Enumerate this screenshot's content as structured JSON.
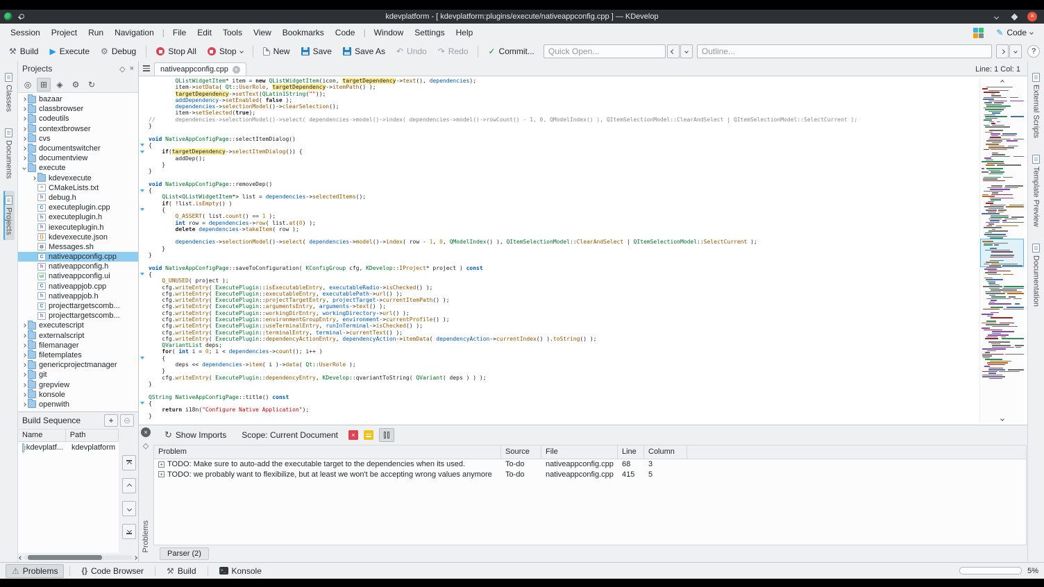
{
  "titlebar": {
    "title": "kdevplatform - [ kdevplatform:plugins/execute/nativeappconfig.cpp ] — KDevelop"
  },
  "icons": {
    "close": "×",
    "float": "◇",
    "add": "+",
    "remove": "⊖",
    "help": "?",
    "pencil": "✎",
    "refresh": "↻",
    "warning": "⚠",
    "hammer": "⚒",
    "gear": "⚙",
    "play": "▶",
    "undo": "↶",
    "redo": "↷",
    "check": "✓",
    "braces": "{}",
    "locate": "◎",
    "grid": "⊞",
    "diamond": "◈",
    "plus_box": "+"
  },
  "menubar": {
    "items": [
      "Session",
      "Project",
      "Run",
      "Navigation",
      "|",
      "File",
      "Edit",
      "Tools",
      "View",
      "Bookmarks",
      "Code",
      "|",
      "Window",
      "Settings",
      "Help"
    ],
    "area_button": "Code"
  },
  "toolbar": {
    "buttons": [
      {
        "label": "Build",
        "icon": "build"
      },
      {
        "label": "Execute",
        "icon": "execute"
      },
      {
        "label": "Debug",
        "icon": "debug"
      },
      {
        "sep": true
      },
      {
        "label": "Stop All",
        "icon": "stop"
      },
      {
        "label": "Stop",
        "icon": "stop",
        "dropdown": true
      },
      {
        "sep": true
      },
      {
        "label": "New",
        "icon": "new"
      },
      {
        "label": "Save",
        "icon": "save"
      },
      {
        "label": "Save As",
        "icon": "saveas"
      },
      {
        "label": "Undo",
        "icon": "undo",
        "disabled": true
      },
      {
        "label": "Redo",
        "icon": "redo",
        "disabled": true
      },
      {
        "sep": true
      },
      {
        "label": "Commit...",
        "icon": "commit"
      }
    ],
    "quick_open_placeholder": "Quick Open...",
    "outline_placeholder": "Outline...",
    "help_label": "?"
  },
  "left_dock": {
    "tabs": [
      {
        "label": "Classes",
        "active": false
      },
      {
        "label": "Documents",
        "active": false
      },
      {
        "label": "Projects",
        "active": true
      }
    ]
  },
  "right_dock": {
    "tabs": [
      {
        "label": "External Scripts"
      },
      {
        "label": "Template Preview"
      },
      {
        "label": "Documentation"
      }
    ]
  },
  "projects_panel": {
    "title": "Projects",
    "tree": [
      {
        "label": "bazaar",
        "depth": 0,
        "icon": "folder",
        "arrow": "right"
      },
      {
        "label": "classbrowser",
        "depth": 0,
        "icon": "folder",
        "arrow": "right"
      },
      {
        "label": "codeutils",
        "depth": 0,
        "icon": "folder",
        "arrow": "right"
      },
      {
        "label": "contextbrowser",
        "depth": 0,
        "icon": "folder",
        "arrow": "right"
      },
      {
        "label": "cvs",
        "depth": 0,
        "icon": "folder",
        "arrow": "right"
      },
      {
        "label": "documentswitcher",
        "depth": 0,
        "icon": "folder",
        "arrow": "right"
      },
      {
        "label": "documentview",
        "depth": 0,
        "icon": "folder",
        "arrow": "right"
      },
      {
        "label": "execute",
        "depth": 0,
        "icon": "folder",
        "arrow": "down"
      },
      {
        "label": "kdevexecute",
        "depth": 1,
        "icon": "folder",
        "arrow": "right"
      },
      {
        "label": "CMakeLists.txt",
        "depth": 1,
        "icon": "txt"
      },
      {
        "label": "debug.h",
        "depth": 1,
        "icon": "h"
      },
      {
        "label": "executeplugin.cpp",
        "depth": 1,
        "icon": "cpp"
      },
      {
        "label": "executeplugin.h",
        "depth": 1,
        "icon": "h"
      },
      {
        "label": "iexecuteplugin.h",
        "depth": 1,
        "icon": "h"
      },
      {
        "label": "kdevexecute.json",
        "depth": 1,
        "icon": "json"
      },
      {
        "label": "Messages.sh",
        "depth": 1,
        "icon": "sh"
      },
      {
        "label": "nativeappconfig.cpp",
        "depth": 1,
        "icon": "cpp",
        "selected": true
      },
      {
        "label": "nativeappconfig.h",
        "depth": 1,
        "icon": "h"
      },
      {
        "label": "nativeappconfig.ui",
        "depth": 1,
        "icon": "ui"
      },
      {
        "label": "nativeappjob.cpp",
        "depth": 1,
        "icon": "cpp"
      },
      {
        "label": "nativeappjob.h",
        "depth": 1,
        "icon": "h"
      },
      {
        "label": "projecttargetscomb...",
        "depth": 1,
        "icon": "cpp"
      },
      {
        "label": "projecttargetscomb...",
        "depth": 1,
        "icon": "h"
      },
      {
        "label": "executescript",
        "depth": 0,
        "icon": "folder",
        "arrow": "right"
      },
      {
        "label": "externalscript",
        "depth": 0,
        "icon": "folder",
        "arrow": "right"
      },
      {
        "label": "filemanager",
        "depth": 0,
        "icon": "folder",
        "arrow": "right"
      },
      {
        "label": "filetemplates",
        "depth": 0,
        "icon": "folder",
        "arrow": "right"
      },
      {
        "label": "genericprojectmanager",
        "depth": 0,
        "icon": "folder",
        "arrow": "right"
      },
      {
        "label": "git",
        "depth": 0,
        "icon": "folder",
        "arrow": "right"
      },
      {
        "label": "grepview",
        "depth": 0,
        "icon": "folder",
        "arrow": "right"
      },
      {
        "label": "konsole",
        "depth": 0,
        "icon": "folder",
        "arrow": "right"
      },
      {
        "label": "openwith",
        "depth": 0,
        "icon": "folder",
        "arrow": "right"
      }
    ]
  },
  "build_sequence": {
    "title": "Build Sequence",
    "columns": [
      "Name",
      "Path"
    ],
    "rows": [
      {
        "name": "kdevplatf...",
        "path": "kdevplatform"
      }
    ]
  },
  "editor": {
    "tab_title": "nativeappconfig.cpp",
    "cursor_status": "Line: 1 Col: 1",
    "code_lines": [
      "        QListWidgetItem* item = new QListWidgetItem(icon, targetDependency->text(), dependencies);",
      "        item->setData( Qt::UserRole, targetDependency->itemPath() );",
      "        targetDependency->setText(QLatin1String(\"\"));",
      "        addDependency->setEnabled( false );",
      "        dependencies->selectionModel()->clearSelection();",
      "        item->setSelected(true);",
      "//      dependencies->selectionModel()->select( dependencies->model()->index( dependencies->model()->rowCount() - 1, 0, QModelIndex() ), QItemSelectionModel::ClearAndSelect | QItemSelectionModel::SelectCurrent );",
      "}",
      "",
      "void NativeAppConfigPage::selectItemDialog()",
      "{",
      "    if(targetDependency->selectItemDialog()) {",
      "        addDep();",
      "    }",
      "}",
      "",
      "void NativeAppConfigPage::removeDep()",
      "{",
      "    QList<QListWidgetItem*> list = dependencies->selectedItems();",
      "    if( !list.isEmpty() )",
      "    {",
      "        Q_ASSERT( list.count() == 1 );",
      "        int row = dependencies->row( list.at(0) );",
      "        delete dependencies->takeItem( row );",
      "",
      "        dependencies->selectionModel()->select( dependencies->model()->index( row - 1, 0, QModelIndex() ), QItemSelectionModel::ClearAndSelect | QItemSelectionModel::SelectCurrent );",
      "    }",
      "}",
      "",
      "void NativeAppConfigPage::saveToConfiguration( KConfigGroup cfg, KDevelop::IProject* project ) const",
      "{",
      "    Q_UNUSED( project );",
      "    cfg.writeEntry( ExecutePlugin::isExecutableEntry, executableRadio->isChecked() );",
      "    cfg.writeEntry( ExecutePlugin::executableEntry, executablePath->url() );",
      "    cfg.writeEntry( ExecutePlugin::projectTargetEntry, projectTarget->currentItemPath() );",
      "    cfg.writeEntry( ExecutePlugin::argumentsEntry, arguments->text() );",
      "    cfg.writeEntry( ExecutePlugin::workingDirEntry, workingDirectory->url() );",
      "    cfg.writeEntry( ExecutePlugin::environmentGroupEntry, environment->currentProfile() );",
      "    cfg.writeEntry( ExecutePlugin::useTerminalEntry, runInTerminal->isChecked() );",
      "    cfg.writeEntry( ExecutePlugin::terminalEntry, terminal->currentText() );",
      "    cfg.writeEntry( ExecutePlugin::dependencyActionEntry, dependencyAction->itemData( dependencyAction->currentIndex() ).toString() );",
      "    QVariantList deps;",
      "    for( int i = 0; i < dependencies->count(); i++ )",
      "    {",
      "        deps << dependencies->item( i )->data( Qt::UserRole );",
      "    }",
      "    cfg.writeEntry( ExecutePlugin::dependencyEntry, KDevelop::qvariantToString( QVariant( deps ) ) );",
      "}",
      "",
      "QString NativeAppConfigPage::title() const",
      "{",
      "    return i18n(\"Configure Native Application\");",
      "}"
    ]
  },
  "problems_panel": {
    "panel_label": "Problems",
    "show_imports": "Show Imports",
    "scope": "Scope: Current Document",
    "columns": [
      "Problem",
      "Source",
      "File",
      "Line",
      "Column"
    ],
    "rows": [
      {
        "problem": "TODO: Make sure to auto-add the executable target to the dependencies when its used.",
        "source": "To-do",
        "file": "nativeappconfig.cpp",
        "line": "68",
        "column": "3"
      },
      {
        "problem": "TODO: we probably want to flexibilize, but at least we won't be accepting wrong values anymore",
        "source": "To-do",
        "file": "nativeappconfig.cpp",
        "line": "415",
        "column": "5"
      }
    ],
    "tab_label": "Parser (2)"
  },
  "statusbar": {
    "toggles": [
      {
        "label": "Problems",
        "active": true
      },
      {
        "label": "Code Browser",
        "active": false
      },
      {
        "label": "Build",
        "active": false
      },
      {
        "label": "Konsole",
        "active": false
      }
    ],
    "progress_label": "5%",
    "progress_percent": 5
  }
}
